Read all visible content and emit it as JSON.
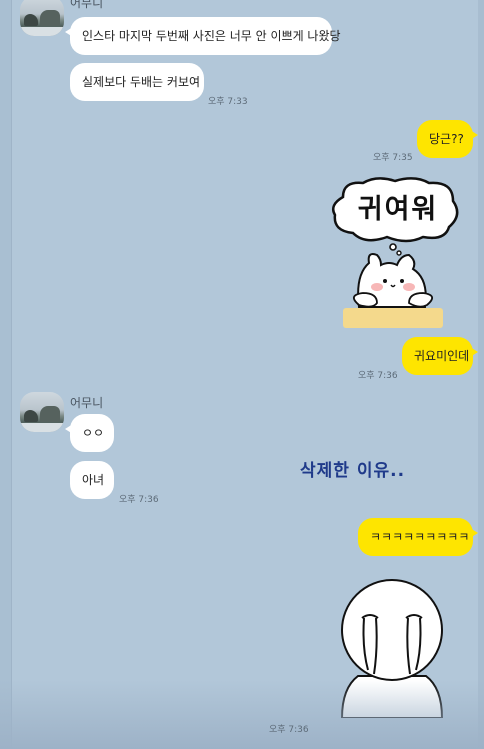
{
  "chat": {
    "partner_name_1": "어무니",
    "partner_name_2": "어무니",
    "messages": {
      "m1": "인스타 마지막 두번째 사진은 너무 안 이쁘게 나왔당",
      "m2": "실제보다 두배는 커보여",
      "m3": "당근??",
      "m4": "귀요미인데",
      "m5": "ㅇㅇ",
      "m6": "아녀",
      "m7": "ㅋㅋㅋㅋㅋㅋㅋㅋㅋ"
    },
    "times": {
      "t1": "오후 7:33",
      "t2": "오후 7:35",
      "t3": "오후 7:36",
      "t4": "오후 7:36",
      "t5": "오후 7:36"
    },
    "sticker_text": "귀여워",
    "overlay_caption": "삭제한 이유.."
  },
  "colors": {
    "background": "#b2c7d9",
    "my_bubble": "#fee500",
    "partner_bubble": "#ffffff",
    "caption": "#1f3a8a"
  },
  "icons": [
    "avatar-photo",
    "bunny-sticker",
    "crying-face-sticker"
  ]
}
